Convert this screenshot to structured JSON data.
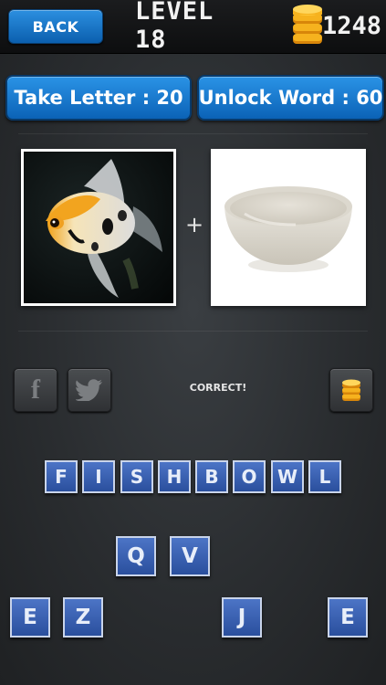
{
  "header": {
    "back_label": "BACK",
    "level_title": "LEVEL 18",
    "coin_count": "1248"
  },
  "hints": {
    "take_letter_label": "Take Letter : 20",
    "unlock_word_label": "Unlock Word : 60"
  },
  "puzzle": {
    "plus": "+",
    "image_left": "angelfish",
    "image_right": "white bowl",
    "status": "CORRECT!"
  },
  "answer": {
    "letters": [
      "F",
      "I",
      "S",
      "H",
      "B",
      "O",
      "W",
      "L"
    ]
  },
  "pool": {
    "letters": [
      "Q",
      "V",
      "E",
      "Z",
      "J",
      "E"
    ]
  },
  "colors": {
    "button_blue": "#0b62b6",
    "tile_blue": "#3a62b5",
    "coin_gold": "#f4a514"
  },
  "icons": {
    "facebook": "facebook-icon",
    "twitter": "twitter-icon",
    "coins": "coin-stack-icon"
  }
}
